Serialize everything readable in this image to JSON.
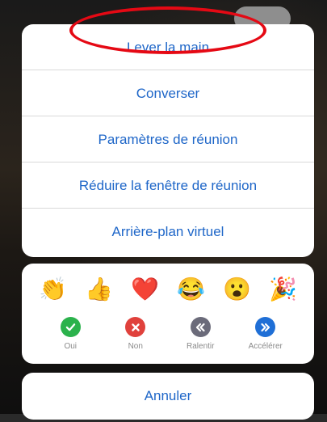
{
  "menu": {
    "items": [
      {
        "label": "Lever la main"
      },
      {
        "label": "Converser"
      },
      {
        "label": "Paramètres de réunion"
      },
      {
        "label": "Réduire la fenêtre de réunion"
      },
      {
        "label": "Arrière-plan virtuel"
      }
    ]
  },
  "reactions": {
    "emojis": [
      {
        "icon": "clapping-hands-icon",
        "glyph": "👏"
      },
      {
        "icon": "thumbs-up-icon",
        "glyph": "👍"
      },
      {
        "icon": "red-heart-icon",
        "glyph": "❤️"
      },
      {
        "icon": "tears-of-joy-icon",
        "glyph": "😂"
      },
      {
        "icon": "open-mouth-icon",
        "glyph": "😮"
      },
      {
        "icon": "party-popper-icon",
        "glyph": "🎉"
      }
    ],
    "feedback": [
      {
        "label": "Oui",
        "icon": "check-icon",
        "color": "#2bb24c"
      },
      {
        "label": "Non",
        "icon": "x-icon",
        "color": "#e0413c"
      },
      {
        "label": "Ralentir",
        "icon": "slow-down-icon",
        "color": "#6b6b7a"
      },
      {
        "label": "Accélérer",
        "icon": "speed-up-icon",
        "color": "#1f6fd6"
      }
    ]
  },
  "cancel": {
    "label": "Annuler"
  },
  "colors": {
    "link": "#1e66c8",
    "highlight_circle": "#e50914"
  }
}
